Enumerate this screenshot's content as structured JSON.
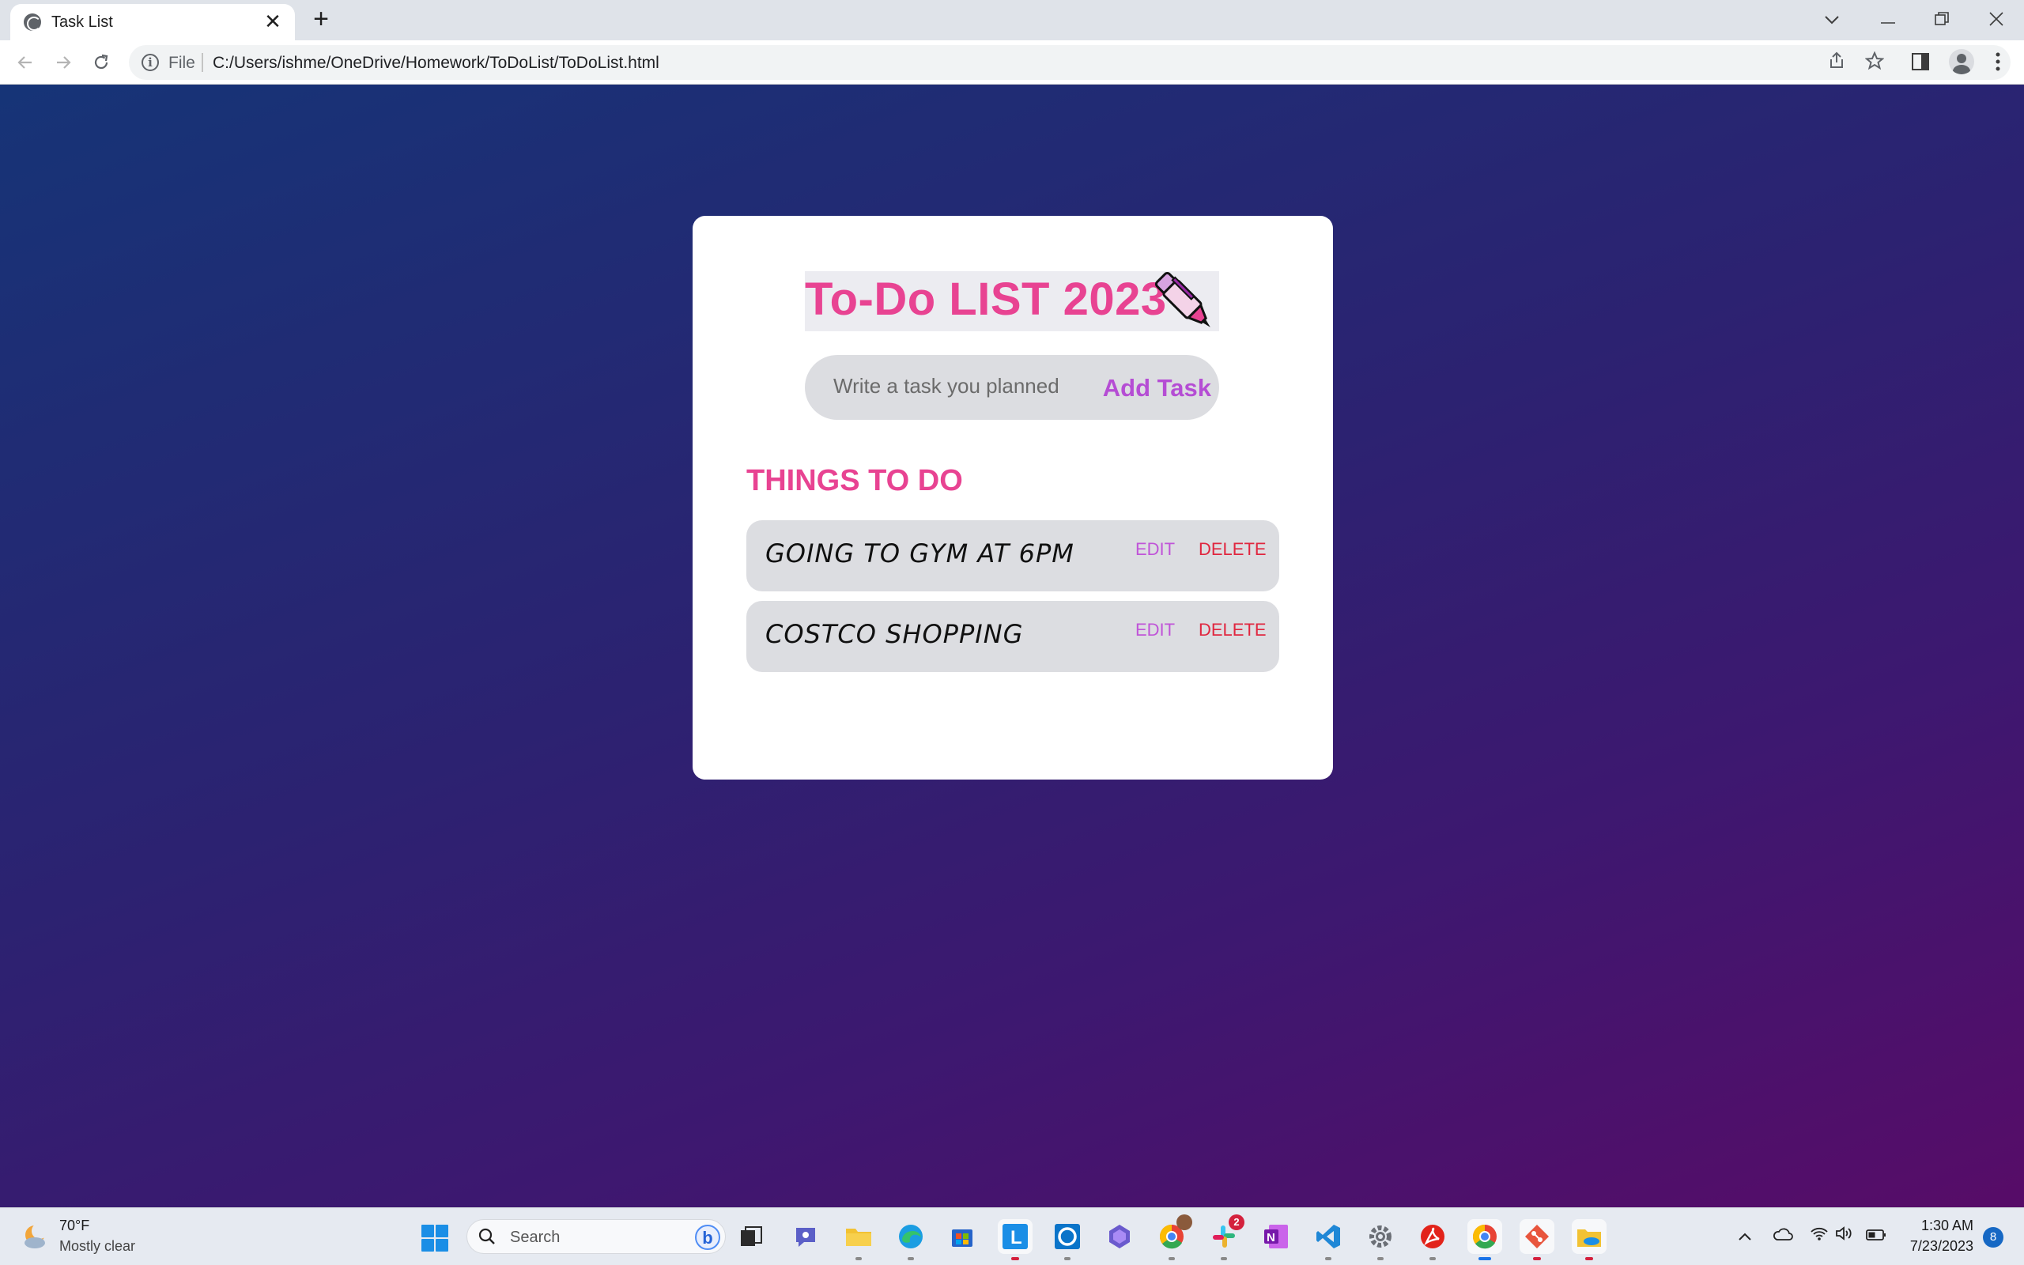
{
  "browser": {
    "tab_title": "Task List",
    "tab_close": "✕",
    "new_tab": "+",
    "file_label": "File",
    "url": "C:/Users/ishme/OneDrive/Homework/ToDoList/ToDoList.html"
  },
  "app": {
    "title": "To-Do LIST 2023",
    "input_placeholder": "Write a task you planned",
    "add_button": "Add Task",
    "section_title": "THINGS TO DO",
    "tasks": [
      {
        "text": "GOING TO GYM AT 6PM",
        "edit": "EDIT",
        "delete": "DELETE"
      },
      {
        "text": "COSTCO SHOPPING",
        "edit": "EDIT",
        "delete": "DELETE"
      }
    ],
    "colors": {
      "accent_pink": "#e84392",
      "accent_purple": "#b54dd4",
      "delete_red": "#e0263f",
      "bg_gradient_start": "#163477",
      "bg_gradient_end": "#570c68"
    }
  },
  "taskbar": {
    "weather_temp": "70°F",
    "weather_desc": "Mostly clear",
    "search_label": "Search",
    "slack_badge": "2",
    "clock_time": "1:30 AM",
    "clock_date": "7/23/2023",
    "notification_count": "8"
  }
}
